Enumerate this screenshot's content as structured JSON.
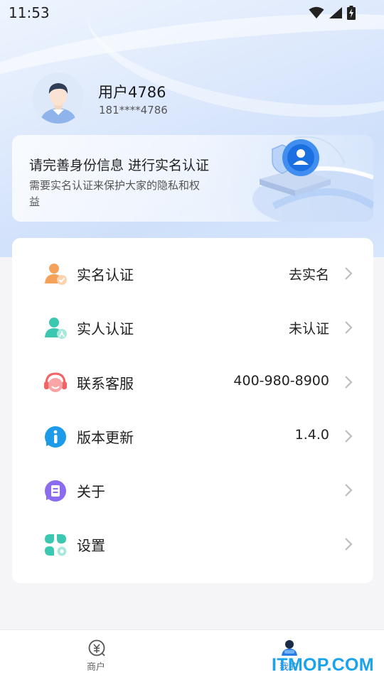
{
  "status_bar": {
    "time": "11:53",
    "icons": [
      "wifi-icon",
      "signal-icon",
      "battery-charging-icon"
    ]
  },
  "profile": {
    "username": "用户4786",
    "phone": "181****4786"
  },
  "verify_banner": {
    "title": "请完善身份信息 进行实名认证",
    "description": "需要实名认证来保护大家的隐私和权益"
  },
  "menu": {
    "items": [
      {
        "label": "实名认证",
        "value": "去实名",
        "icon": "real-name-icon",
        "icon_color": "#f5a15a"
      },
      {
        "label": "实人认证",
        "value": "未认证",
        "icon": "face-verify-icon",
        "icon_color": "#3cc7b0"
      },
      {
        "label": "联系客服",
        "value": "400-980-8900",
        "icon": "customer-service-icon",
        "icon_color": "#f06464"
      },
      {
        "label": "版本更新",
        "value": "1.4.0",
        "icon": "info-icon",
        "icon_color": "#1e9be8"
      },
      {
        "label": "关于",
        "value": "",
        "icon": "about-icon",
        "icon_color": "#8b6cf0"
      },
      {
        "label": "设置",
        "value": "",
        "icon": "settings-icon",
        "icon_color": "#3cc7b0"
      }
    ]
  },
  "bottom_nav": {
    "tabs": [
      {
        "label": "商户",
        "icon": "merchant-icon",
        "active": false
      },
      {
        "label": "我的",
        "icon": "mine-icon",
        "active": true
      }
    ]
  },
  "watermark": "ITMOP.COM",
  "colors": {
    "accent": "#2a7be4",
    "watermark": "#1aa3ea",
    "background": "#f5f5f7"
  }
}
